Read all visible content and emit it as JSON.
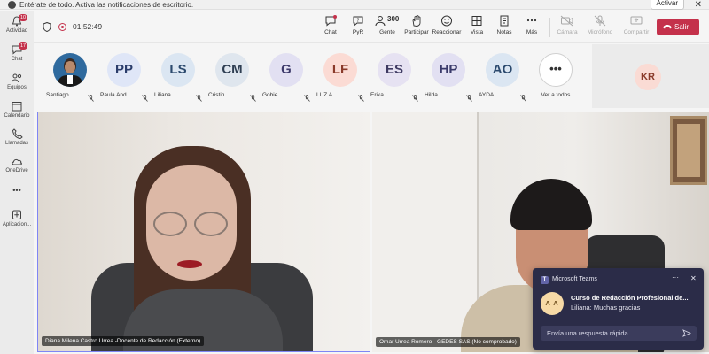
{
  "banner": {
    "text": "Entérate de todo. Activa las notificaciones de escritorio.",
    "activate_label": "Activar",
    "close_label": "✕"
  },
  "rail": {
    "items": [
      {
        "label": "Actividad",
        "badge": "10"
      },
      {
        "label": "Chat",
        "badge": "17"
      },
      {
        "label": "Equipos"
      },
      {
        "label": "Calendario"
      },
      {
        "label": "Llamadas"
      },
      {
        "label": "OneDrive"
      },
      {
        "label": "•••"
      },
      {
        "label": "Aplicacion..."
      }
    ]
  },
  "toolbar": {
    "timer": "01:52:49",
    "chat": "Chat",
    "qna": "PyR",
    "people": "Gente",
    "people_count": "300",
    "participate": "Participar",
    "react": "Reaccionar",
    "view": "Vista",
    "notes": "Notas",
    "more": "Más",
    "camera": "Cámara",
    "mic": "Micrófono",
    "share": "Compartir",
    "leave": "Salir"
  },
  "participants": [
    {
      "initials": "",
      "name": "Santiago ...",
      "bg": "#2f6a9e",
      "fg": "#ffffff"
    },
    {
      "initials": "PP",
      "name": "Paula And...",
      "bg": "#dfe6f7",
      "fg": "#2b3d6b"
    },
    {
      "initials": "LS",
      "name": "Liliana ...",
      "bg": "#dbe6f2",
      "fg": "#2c4a6e"
    },
    {
      "initials": "CM",
      "name": "Cristin...",
      "bg": "#dfe6ee",
      "fg": "#2e3e52"
    },
    {
      "initials": "G",
      "name": "Gobie...",
      "bg": "#e2e0f2",
      "fg": "#3d3a6b"
    },
    {
      "initials": "LF",
      "name": "LUZ A...",
      "bg": "#fbdbd4",
      "fg": "#8a3a2a"
    },
    {
      "initials": "ES",
      "name": "Erika ...",
      "bg": "#e6e2f2",
      "fg": "#3e3a62"
    },
    {
      "initials": "HP",
      "name": "Hilda ...",
      "bg": "#e2e0f2",
      "fg": "#3a3a6a"
    },
    {
      "initials": "AO",
      "name": "AYDA ...",
      "bg": "#dbe6f2",
      "fg": "#2c4a6e"
    }
  ],
  "see_all": {
    "icon": "•••",
    "label": "Ver a todos"
  },
  "kr_tile": {
    "initials": "KR"
  },
  "videos": {
    "left_label": "Diana Milena Castro Urrea -Docente de Redacción (Externo)",
    "right_label": "Omar Urrea Romero - GEDES SAS (No comprobado)"
  },
  "toast": {
    "app_icon": "T",
    "app_name": "Microsoft Teams",
    "more": "···",
    "close": "✕",
    "avatar": "A A",
    "title": "Curso de Redacción Profesional de...",
    "body": "Liliana: Muchas gracias",
    "reply_placeholder": "Envía una respuesta rápida"
  },
  "colors": {
    "leave": "#c4314b",
    "accent": "#6264a7",
    "toast_bg": "#2b2c48",
    "active_tile_border": "#7f85f5"
  }
}
